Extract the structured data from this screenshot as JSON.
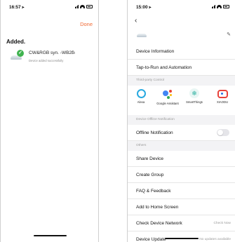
{
  "left": {
    "status": {
      "time": "16:57"
    },
    "done_label": "Done",
    "added_title": "Added.",
    "device": {
      "name": "CW&RGB syn. -WB2L",
      "status": "Device added successfully"
    }
  },
  "right": {
    "status": {
      "time": "15:00"
    },
    "rows": {
      "device_info": "Device Information",
      "tap_to_run": "Tap-to-Run and Automation",
      "offline_notification": "Offline Notification",
      "share_device": "Share Device",
      "create_group": "Create Group",
      "faq": "FAQ & Feedback",
      "add_home": "Add to Home Screen",
      "check_network": "Check Device Network",
      "check_network_value": "Check Now",
      "device_update": "Device Update",
      "device_update_value": "No updates available"
    },
    "sections": {
      "third_party": "Third-party Control",
      "offline": "Device Offline Notification",
      "others": "Others"
    },
    "third_party": [
      {
        "label": "Alexa"
      },
      {
        "label": "Google Assistant"
      },
      {
        "label": "SmartThings"
      },
      {
        "label": "XIAODU"
      }
    ],
    "toggle_offline": false
  },
  "colors": {
    "accent": "#f06a35",
    "success": "#3fb34f",
    "alexa": "#28a9e0",
    "muted": "#9a9a9a"
  }
}
